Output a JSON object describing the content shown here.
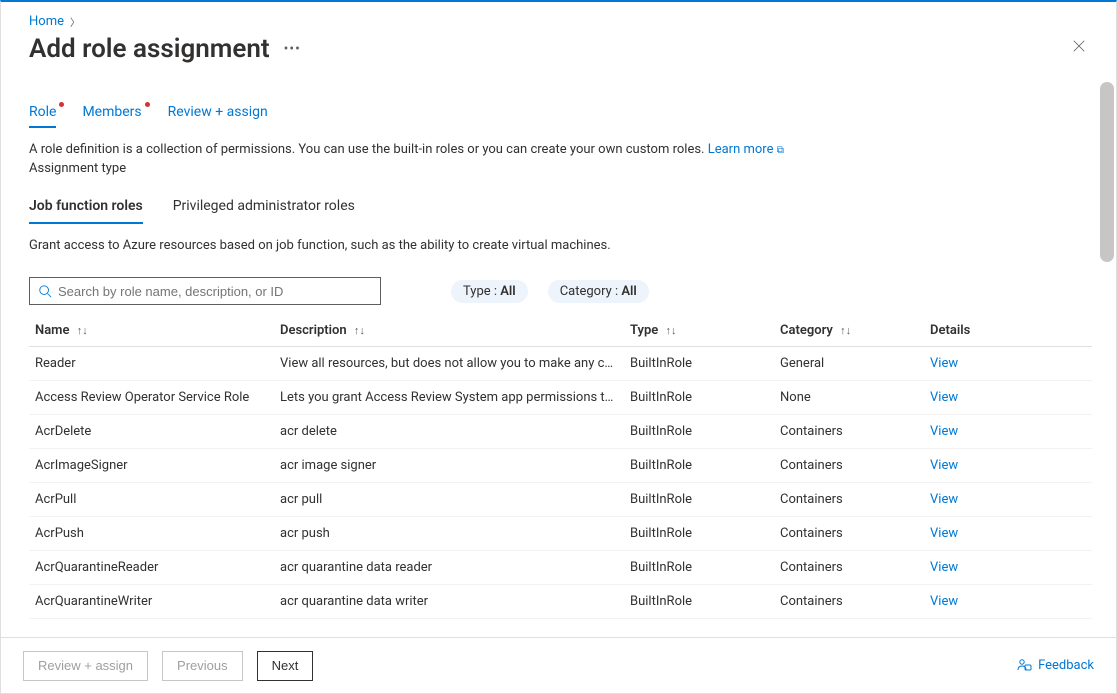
{
  "breadcrumb": {
    "home": "Home"
  },
  "page": {
    "title": "Add role assignment"
  },
  "tabs": {
    "role": "Role",
    "members": "Members",
    "review": "Review + assign"
  },
  "info": {
    "description": "A role definition is a collection of permissions. You can use the built-in roles or you can create your own custom roles. ",
    "learn_more": "Learn more",
    "assignment_type": "Assignment type"
  },
  "subtabs": {
    "job": "Job function roles",
    "priv": "Privileged administrator roles"
  },
  "grant_text": "Grant access to Azure resources based on job function, such as the ability to create virtual machines.",
  "search": {
    "placeholder": "Search by role name, description, or ID"
  },
  "filters": {
    "type_label": "Type : ",
    "type_value": "All",
    "category_label": "Category : ",
    "category_value": "All"
  },
  "columns": {
    "name": "Name",
    "description": "Description",
    "type": "Type",
    "category": "Category",
    "details": "Details"
  },
  "sort_glyphs": "↑↓",
  "view_label": "View",
  "rows": [
    {
      "name": "Reader",
      "desc": "View all resources, but does not allow you to make any ch…",
      "type": "BuiltInRole",
      "category": "General"
    },
    {
      "name": "Access Review Operator Service Role",
      "desc": "Lets you grant Access Review System app permissions to …",
      "type": "BuiltInRole",
      "category": "None"
    },
    {
      "name": "AcrDelete",
      "desc": "acr delete",
      "type": "BuiltInRole",
      "category": "Containers"
    },
    {
      "name": "AcrImageSigner",
      "desc": "acr image signer",
      "type": "BuiltInRole",
      "category": "Containers"
    },
    {
      "name": "AcrPull",
      "desc": "acr pull",
      "type": "BuiltInRole",
      "category": "Containers"
    },
    {
      "name": "AcrPush",
      "desc": "acr push",
      "type": "BuiltInRole",
      "category": "Containers"
    },
    {
      "name": "AcrQuarantineReader",
      "desc": "acr quarantine data reader",
      "type": "BuiltInRole",
      "category": "Containers"
    },
    {
      "name": "AcrQuarantineWriter",
      "desc": "acr quarantine data writer",
      "type": "BuiltInRole",
      "category": "Containers"
    }
  ],
  "footer": {
    "review": "Review + assign",
    "previous": "Previous",
    "next": "Next",
    "feedback": "Feedback"
  }
}
